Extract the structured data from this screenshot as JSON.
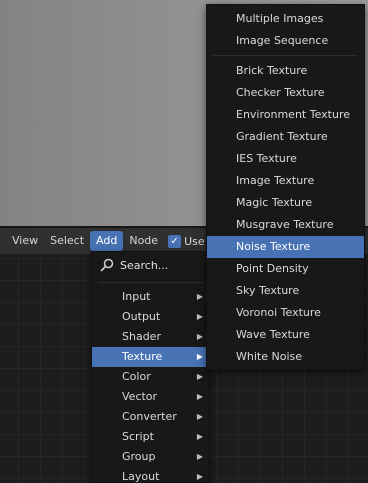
{
  "header": {
    "items": [
      {
        "label": "View"
      },
      {
        "label": "Select"
      },
      {
        "label": "Add"
      },
      {
        "label": "Node"
      }
    ],
    "use_label": "Use",
    "use_checked": true
  },
  "add_menu": {
    "search": {
      "label": "Search...",
      "icon": "search-icon"
    },
    "items": [
      {
        "label": "Input"
      },
      {
        "label": "Output"
      },
      {
        "label": "Shader"
      },
      {
        "label": "Texture"
      },
      {
        "label": "Color"
      },
      {
        "label": "Vector"
      },
      {
        "label": "Converter"
      },
      {
        "label": "Script"
      },
      {
        "label": "Group"
      },
      {
        "label": "Layout"
      }
    ],
    "active": "Texture"
  },
  "texture_menu": {
    "group1": [
      {
        "label": "Multiple Images"
      },
      {
        "label": "Image Sequence"
      }
    ],
    "group2": [
      {
        "label": "Brick Texture"
      },
      {
        "label": "Checker Texture"
      },
      {
        "label": "Environment Texture"
      },
      {
        "label": "Gradient Texture"
      },
      {
        "label": "IES Texture"
      },
      {
        "label": "Image Texture"
      },
      {
        "label": "Magic Texture"
      },
      {
        "label": "Musgrave Texture"
      },
      {
        "label": "Noise Texture"
      },
      {
        "label": "Point Density"
      },
      {
        "label": "Sky Texture"
      },
      {
        "label": "Voronoi Texture"
      },
      {
        "label": "Wave Texture"
      },
      {
        "label": "White Noise"
      }
    ],
    "active": "Noise Texture"
  },
  "colors": {
    "accent": "#4772b3",
    "menu_bg": "#181818",
    "header_bg": "#303030"
  }
}
